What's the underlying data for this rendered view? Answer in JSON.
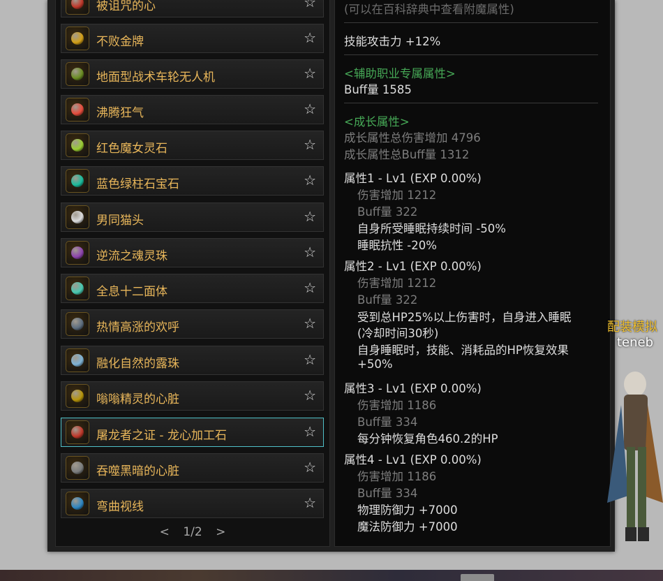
{
  "items": [
    {
      "label": "被诅咒的心",
      "icon": "cursed-heart-icon",
      "color": "#c0392b"
    },
    {
      "label": "不败金牌",
      "icon": "gold-medal-icon",
      "color": "#d4a017"
    },
    {
      "label": "地面型战术车轮无人机",
      "icon": "wheel-drone-icon",
      "color": "#6b8e23"
    },
    {
      "label": "沸腾狂气",
      "icon": "boiling-frenzy-icon",
      "color": "#e74c3c"
    },
    {
      "label": "红色魔女灵石",
      "icon": "witch-stone-icon",
      "color": "#9acd32"
    },
    {
      "label": "蓝色绿柱石宝石",
      "icon": "beryl-gem-icon",
      "color": "#1abc9c"
    },
    {
      "label": "男同猫头",
      "icon": "cat-head-icon",
      "color": "#dcdcdc"
    },
    {
      "label": "逆流之魂灵珠",
      "icon": "soul-orb-icon",
      "color": "#8e44ad"
    },
    {
      "label": "全息十二面体",
      "icon": "dodecahedron-icon",
      "color": "#48c9b0"
    },
    {
      "label": "热情高涨的欢呼",
      "icon": "cheer-icon",
      "color": "#5d6d7e"
    },
    {
      "label": "融化自然的露珠",
      "icon": "dew-drop-icon",
      "color": "#7fb3d5"
    },
    {
      "label": "嗡嗡精灵的心脏",
      "icon": "fairy-heart-icon",
      "color": "#b7950b"
    },
    {
      "label": "屠龙者之证 - 龙心加工石",
      "icon": "dragon-heart-icon",
      "color": "#c0392b"
    },
    {
      "label": "吞噬黑暗的心脏",
      "icon": "dark-eye-icon",
      "color": "#7b7d7d"
    },
    {
      "label": "弯曲视线",
      "icon": "curved-sight-icon",
      "color": "#2e86c1"
    }
  ],
  "selected_index": 12,
  "star_glyph": "☆",
  "pager": {
    "prev": "<",
    "current": "1/2",
    "next": ">"
  },
  "detail": {
    "hint": "(可以在百科辞典中查看附魔属性)",
    "skill_attack": "技能攻击力  +12%",
    "support_header": "<辅助职业专属属性>",
    "buff_value": "Buff量  1585",
    "growth_header": "<成长属性>",
    "growth_total_damage": "成长属性总伤害增加 4796",
    "growth_total_buff": "成长属性总Buff量 1312",
    "attr1": {
      "title": "属性1 - Lv1 (EXP 0.00%)",
      "damage": "伤害增加  1212",
      "buff": "Buff量  322",
      "effect1": "自身所受睡眠持续时间 -50%",
      "effect2": "睡眠抗性 -20%"
    },
    "attr2": {
      "title": "属性2 - Lv1 (EXP 0.00%)",
      "damage": "伤害增加  1212",
      "buff": "Buff量  322",
      "effect1a": "受到总HP25%以上伤害时，自身进入睡眠",
      "effect1b": "(冷却时间30秒)",
      "effect2a": "自身睡眠时，技能、消耗品的HP恢复效果",
      "effect2b": "+50%"
    },
    "attr3": {
      "title": "属性3 - Lv1 (EXP 0.00%)",
      "damage": "伤害增加  1186",
      "buff": "Buff量  334",
      "effect1": "每分钟恢复角色460.2的HP"
    },
    "attr4": {
      "title": "属性4 - Lv1 (EXP 0.00%)",
      "damage": "伤害增加  1186",
      "buff": "Buff量  334",
      "effect1": "物理防御力 +7000",
      "effect2": "魔法防御力 +7000"
    }
  },
  "side": {
    "title": "配装模拟",
    "name": "teneb"
  }
}
